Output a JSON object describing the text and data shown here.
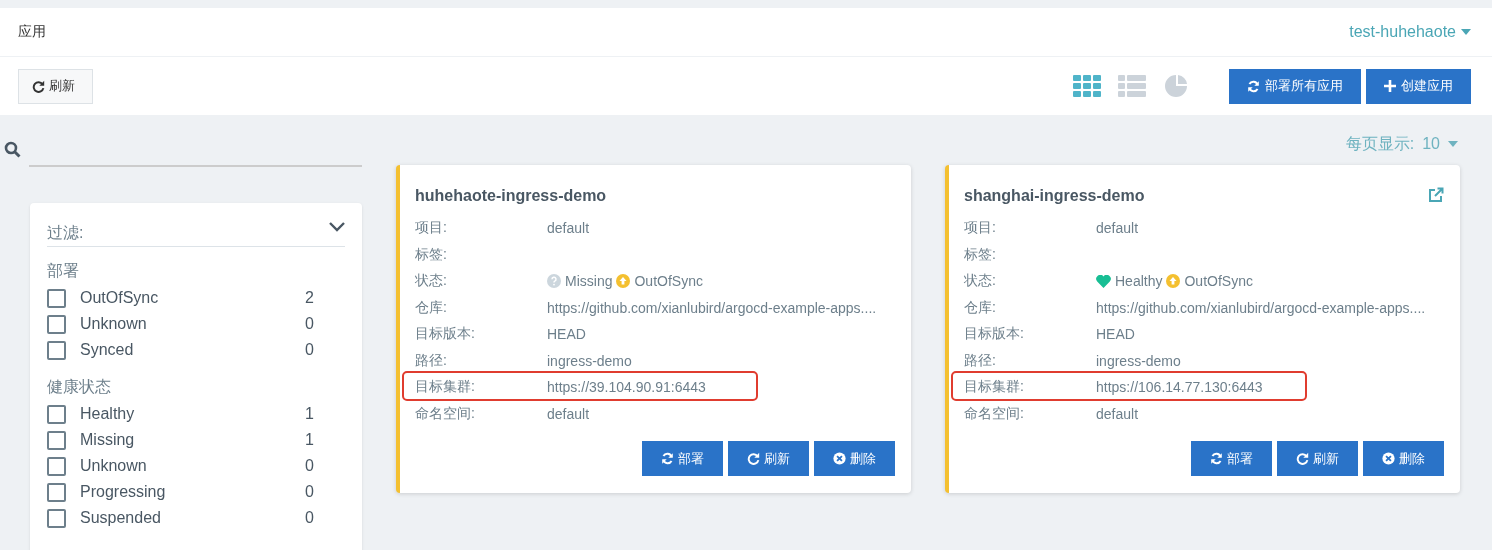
{
  "header": {
    "title": "应用",
    "namespace": "test-huhehaote"
  },
  "toolbar": {
    "refresh": "刷新",
    "views": [
      {
        "kind": "tiles",
        "selected": true
      },
      {
        "kind": "list",
        "selected": false
      },
      {
        "kind": "summary",
        "selected": false
      }
    ],
    "buttons": [
      {
        "kind": "sync",
        "label": "部署所有应用"
      },
      {
        "kind": "add",
        "label": "创建应用"
      }
    ]
  },
  "page_size": {
    "label": "每页显示:",
    "value": "10"
  },
  "filter": {
    "title": "过滤:",
    "expanded": true,
    "groups": [
      {
        "title": "部署",
        "items": [
          {
            "label": "OutOfSync",
            "count": "2",
            "checked": false
          },
          {
            "label": "Unknown",
            "count": "0",
            "checked": false
          },
          {
            "label": "Synced",
            "count": "0",
            "checked": false
          }
        ]
      },
      {
        "title": "健康状态",
        "items": [
          {
            "label": "Healthy",
            "count": "1",
            "checked": false
          },
          {
            "label": "Missing",
            "count": "1",
            "checked": false
          },
          {
            "label": "Unknown",
            "count": "0",
            "checked": false
          },
          {
            "label": "Progressing",
            "count": "0",
            "checked": false
          },
          {
            "label": "Suspended",
            "count": "0",
            "checked": false
          }
        ]
      }
    ]
  },
  "apps": [
    {
      "name": "huhehaote-ingress-demo",
      "external_link": false,
      "fields": [
        {
          "label": "项目:",
          "value": "default",
          "highlighted": false
        },
        {
          "label": "标签:",
          "highlighted": false
        },
        {
          "label": "状态:",
          "kind": "status",
          "health": {
            "kind": "missing",
            "label": "Missing"
          },
          "sync": {
            "kind": "outofsync",
            "label": "OutOfSync"
          },
          "highlighted": false
        },
        {
          "label": "仓库:",
          "value": "https://github.com/xianlubird/argocd-example-apps....",
          "highlighted": false
        },
        {
          "label": "目标版本:",
          "value": "HEAD",
          "highlighted": false
        },
        {
          "label": "路径:",
          "value": "ingress-demo",
          "highlighted": false
        },
        {
          "label": "目标集群:",
          "value": "https://39.104.90.91:6443",
          "highlighted": true
        },
        {
          "label": "命名空间:",
          "value": "default",
          "highlighted": false
        }
      ],
      "actions": [
        {
          "kind": "sync",
          "label": "部署"
        },
        {
          "kind": "refresh",
          "label": "刷新"
        },
        {
          "kind": "delete",
          "label": "删除"
        }
      ]
    },
    {
      "name": "shanghai-ingress-demo",
      "external_link": true,
      "fields": [
        {
          "label": "项目:",
          "value": "default",
          "highlighted": false
        },
        {
          "label": "标签:",
          "highlighted": false
        },
        {
          "label": "状态:",
          "kind": "status",
          "health": {
            "kind": "healthy",
            "label": "Healthy"
          },
          "sync": {
            "kind": "outofsync",
            "label": "OutOfSync"
          },
          "highlighted": false
        },
        {
          "label": "仓库:",
          "value": "https://github.com/xianlubird/argocd-example-apps....",
          "highlighted": false
        },
        {
          "label": "目标版本:",
          "value": "HEAD",
          "highlighted": false
        },
        {
          "label": "路径:",
          "value": "ingress-demo",
          "highlighted": false
        },
        {
          "label": "目标集群:",
          "value": "https://106.14.77.130:6443",
          "highlighted": true
        },
        {
          "label": "命名空间:",
          "value": "default",
          "highlighted": false
        }
      ],
      "actions": [
        {
          "kind": "sync",
          "label": "部署"
        },
        {
          "kind": "refresh",
          "label": "刷新"
        },
        {
          "kind": "delete",
          "label": "删除"
        }
      ]
    }
  ]
}
